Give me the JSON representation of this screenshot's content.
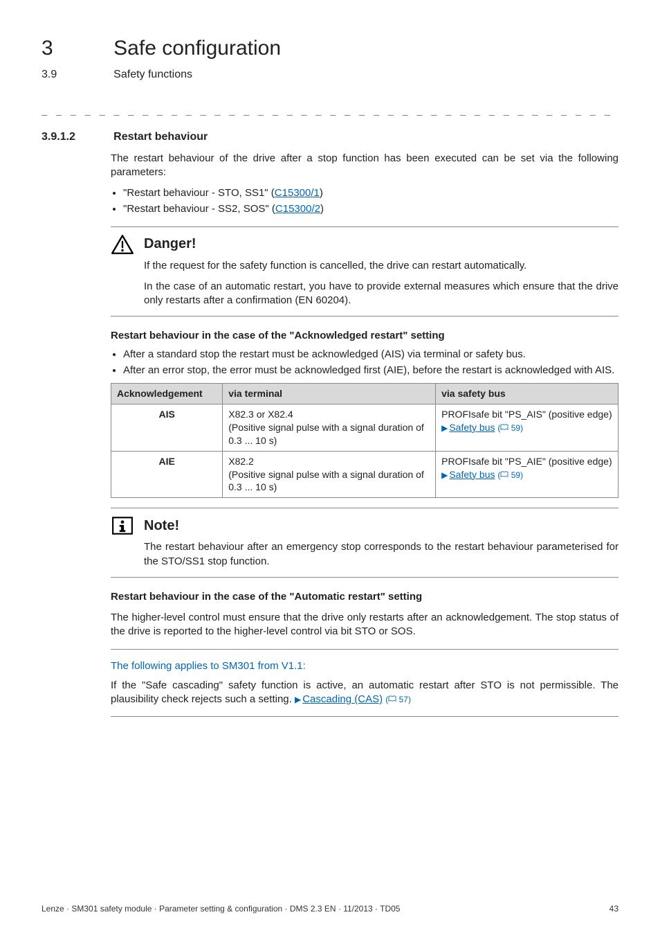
{
  "chapter": {
    "num": "3",
    "title": "Safe configuration"
  },
  "section": {
    "num": "3.9",
    "title": "Safety functions"
  },
  "subsection": {
    "num": "3.9.1.2",
    "title": "Restart behaviour"
  },
  "intro": "The restart behaviour of the drive after a stop function has been executed can be set via the following parameters:",
  "param_bullets": [
    {
      "prefix": "\"Restart behaviour - STO, SS1\" (",
      "link": "C15300/1",
      "suffix": ")"
    },
    {
      "prefix": "\"Restart behaviour - SS2, SOS\" (",
      "link": "C15300/2",
      "suffix": ")"
    }
  ],
  "danger": {
    "title": "Danger!",
    "p1": "If the request for the safety function is cancelled, the drive can restart automatically.",
    "p2": "In the case of an automatic restart, you have to provide external measures which ensure that the drive only restarts after a confirmation (EN 60204)."
  },
  "ack_heading": "Restart behaviour in the case of the \"Acknowledged restart\" setting",
  "ack_bullets": [
    "After a standard stop the restart must be acknowledged (AIS) via terminal or safety bus.",
    "After an error stop, the error must be acknowledged first (AIE), before the restart is acknowledged with AIS."
  ],
  "table": {
    "headers": {
      "c1": "Acknowledgement",
      "c2": "via terminal",
      "c3": "via safety bus"
    },
    "rows": [
      {
        "ack": "AIS",
        "terminal": "X82.3 or X82.4\n(Positive signal pulse with a signal duration of 0.3 ... 10 s)",
        "bus_line1": "PROFIsafe bit \"PS_AIS\" (positive edge)",
        "bus_link": "Safety bus",
        "bus_page": "59"
      },
      {
        "ack": "AIE",
        "terminal": "X82.2\n(Positive signal pulse with a signal duration of 0.3 ... 10 s)",
        "bus_line1": "PROFIsafe bit \"PS_AIE\" (positive edge)",
        "bus_link": "Safety bus",
        "bus_page": "59"
      }
    ]
  },
  "note": {
    "title": "Note!",
    "body": "The restart behaviour after an emergency stop corresponds to the restart behaviour parameterised for the STO/SS1 stop function."
  },
  "auto_heading": "Restart behaviour in the case of the \"Automatic restart\" setting",
  "auto_body": "The higher-level control must ensure that the drive only restarts after an acknowledgement. The stop status of the drive is reported to the higher-level control via bit STO or SOS.",
  "applies": "The following applies to SM301 from V1.1:",
  "cascade": {
    "prefix": "If the \"Safe cascading\" safety function is active, an automatic restart after STO is not permissible. The plausibility check rejects such a setting.  ",
    "link": "Cascading (CAS)",
    "page": "57"
  },
  "footer": {
    "left": "Lenze · SM301 safety module · Parameter setting & configuration · DMS 2.3 EN · 11/2013 · TD05",
    "right": "43"
  },
  "dashes": "_ _ _ _ _ _ _ _ _ _ _ _ _ _ _ _ _ _ _ _ _ _ _ _ _ _ _ _ _ _ _ _ _ _ _ _ _ _ _ _ _ _ _ _ _ _ _ _ _ _ _ _ _ _ _ _ _ _ _ _ _ _ _ _"
}
